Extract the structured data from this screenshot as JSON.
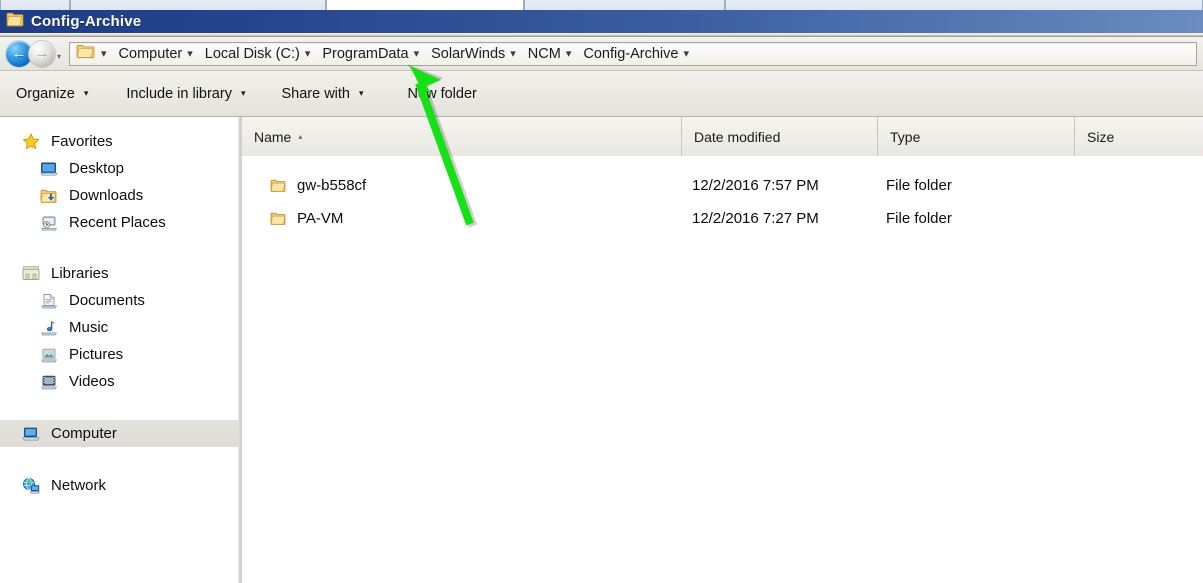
{
  "window": {
    "title": "Config-Archive",
    "title_icon": "folder-icon"
  },
  "tabstrip": {
    "tabs": [
      {
        "label": "",
        "active": false
      },
      {
        "label": "",
        "active": false
      },
      {
        "label": "",
        "active": true
      },
      {
        "label": "",
        "active": false
      },
      {
        "label": "",
        "active": false
      }
    ]
  },
  "nav": {
    "back_label": "←",
    "back_name": "back-button",
    "forward_label": "→",
    "forward_name": "forward-button",
    "history_chevron": "▾",
    "breadcrumbs": [
      {
        "label": "Computer",
        "sep": "▾"
      },
      {
        "label": "Local Disk (C:)",
        "sep": "▾"
      },
      {
        "label": "ProgramData",
        "sep": "▾"
      },
      {
        "label": "SolarWinds",
        "sep": "▾"
      },
      {
        "label": "NCM",
        "sep": "▾"
      },
      {
        "label": "Config-Archive",
        "sep": "▾"
      }
    ]
  },
  "toolbar": {
    "items": [
      {
        "label": "Organize",
        "chevron": "▾"
      },
      {
        "label": "Include in library",
        "chevron": "▾"
      },
      {
        "label": "Share with",
        "chevron": "▾"
      },
      {
        "label": "New folder",
        "chevron": ""
      }
    ]
  },
  "sidebar": {
    "groups": [
      {
        "header": {
          "label": "Favorites",
          "icon": "star-icon"
        },
        "items": [
          {
            "label": "Desktop",
            "icon": "desktop-icon"
          },
          {
            "label": "Downloads",
            "icon": "downloads-folder-icon"
          },
          {
            "label": "Recent Places",
            "icon": "recent-places-icon"
          }
        ]
      },
      {
        "header": {
          "label": "Libraries",
          "icon": "libraries-icon"
        },
        "items": [
          {
            "label": "Documents",
            "icon": "documents-icon"
          },
          {
            "label": "Music",
            "icon": "music-icon"
          },
          {
            "label": "Pictures",
            "icon": "pictures-icon"
          },
          {
            "label": "Videos",
            "icon": "videos-icon"
          }
        ]
      },
      {
        "header": {
          "label": "Computer",
          "icon": "computer-icon",
          "selected": true
        },
        "items": []
      },
      {
        "header": {
          "label": "Network",
          "icon": "network-icon"
        },
        "items": []
      }
    ]
  },
  "filelist": {
    "columns": [
      {
        "label": "Name",
        "sort": "▴"
      },
      {
        "label": "Date modified",
        "sort": ""
      },
      {
        "label": "Type",
        "sort": ""
      },
      {
        "label": "Size",
        "sort": ""
      }
    ],
    "rows": [
      {
        "name": "gw-b558cf",
        "date_modified": "12/2/2016 7:57 PM",
        "type": "File folder",
        "size": "",
        "icon": "folder-icon"
      },
      {
        "name": "PA-VM",
        "date_modified": "12/2/2016 7:27 PM",
        "type": "File folder",
        "size": "",
        "icon": "folder-icon"
      }
    ]
  },
  "annotation": {
    "arrow_color": "#16e016",
    "arrow_name": "green-annotation-arrow",
    "points_at": "ProgramData"
  },
  "colors": {
    "titlebar_dark": "#1f3d84",
    "titlebar_light": "#6c8cc0",
    "chrome": "#eceae3",
    "selection": "#e0ded7"
  }
}
